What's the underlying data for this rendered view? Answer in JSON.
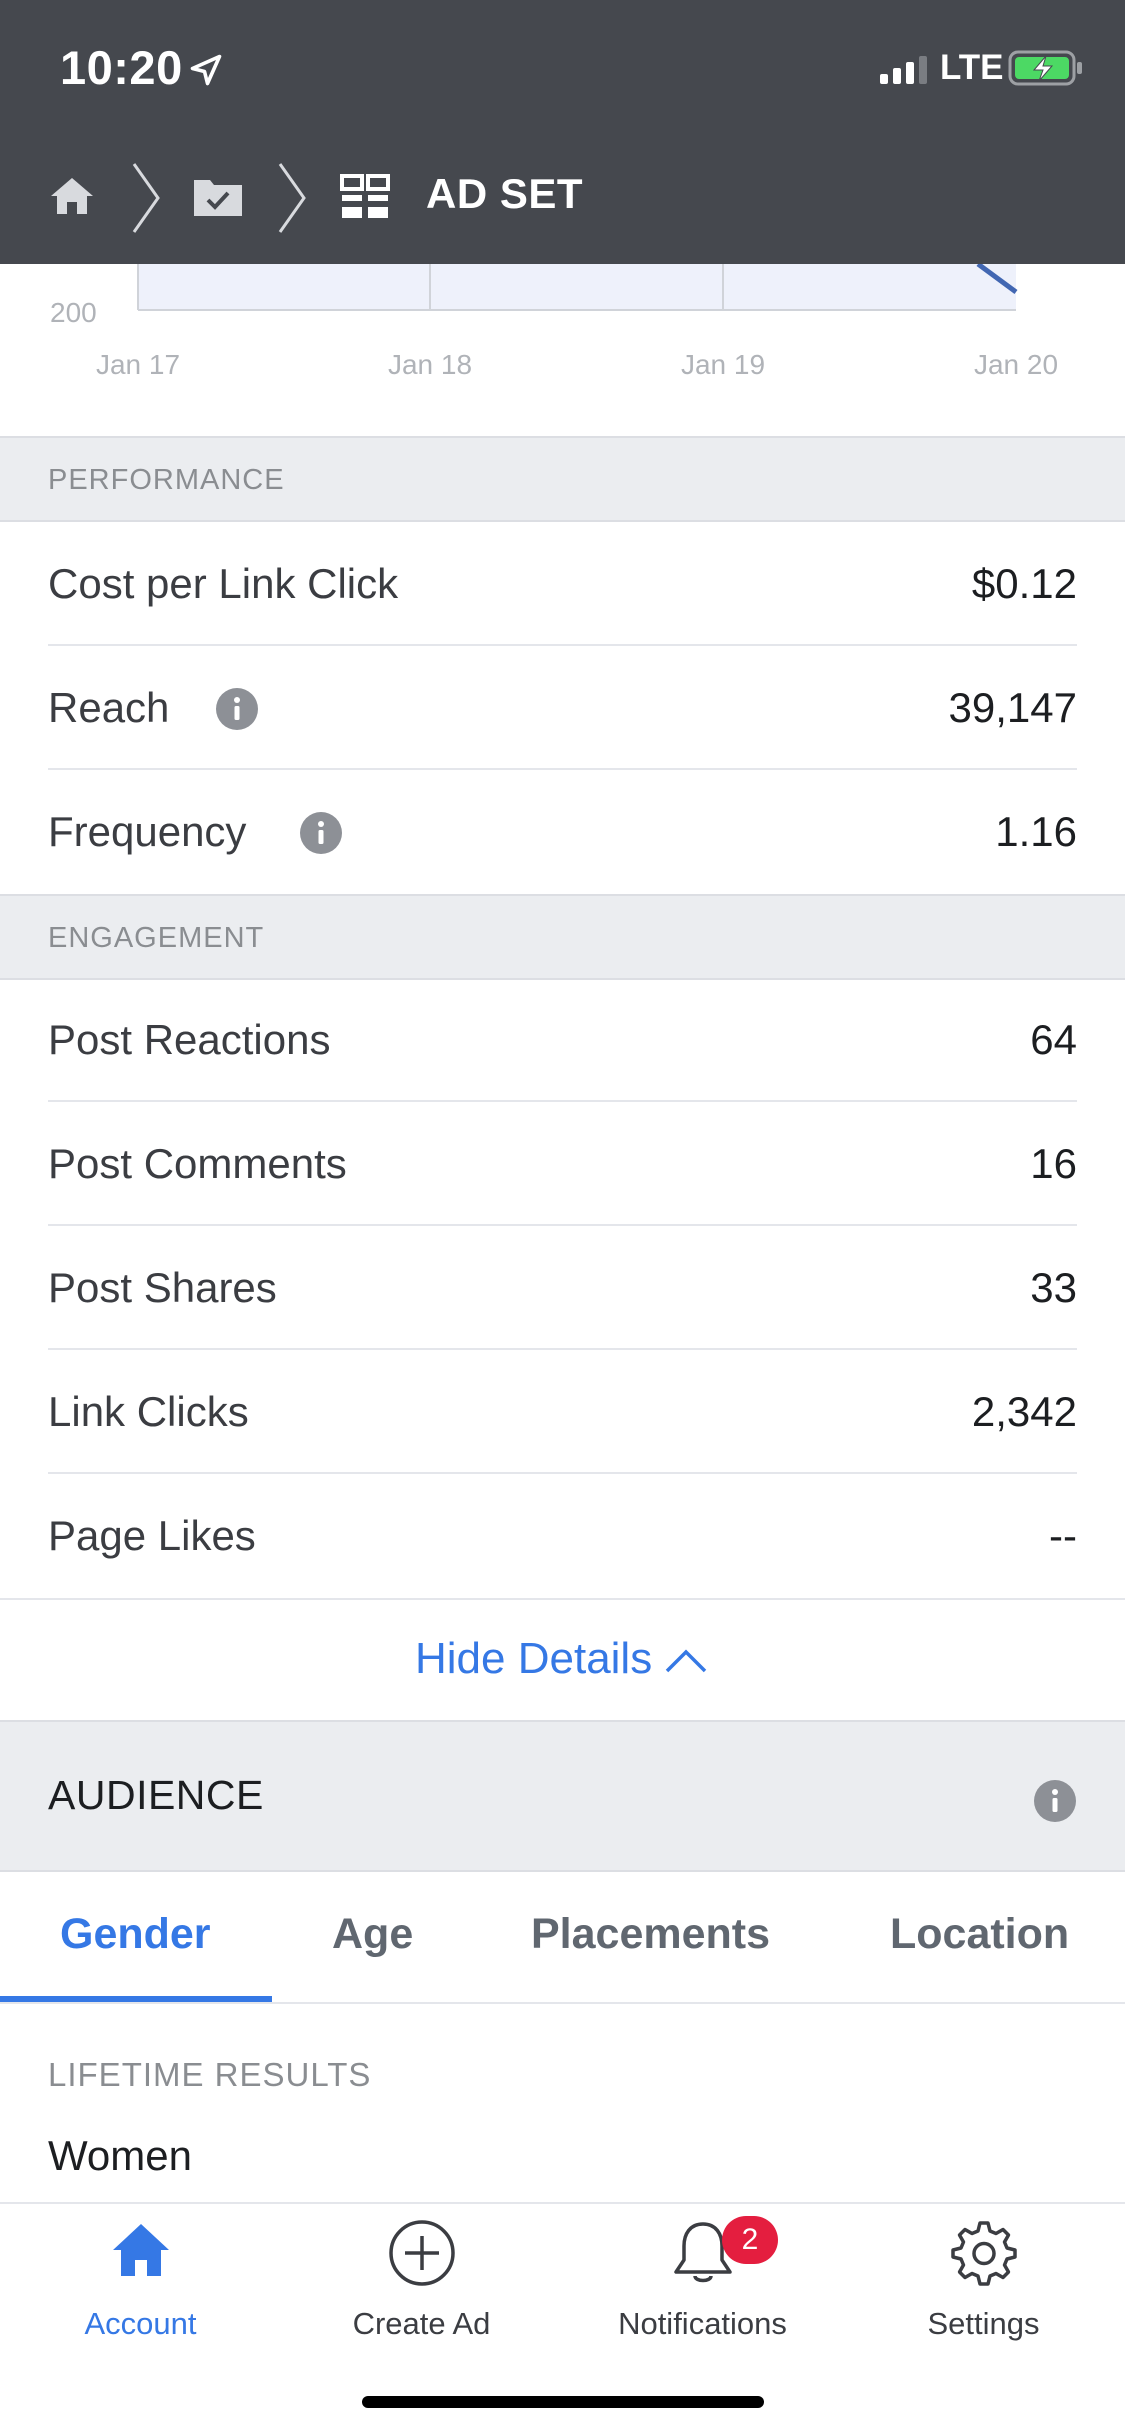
{
  "status_bar": {
    "time": "10:20",
    "network": "LTE"
  },
  "breadcrumb": {
    "title": "AD SET"
  },
  "chart_data": {
    "type": "line",
    "categories": [
      "Jan 17",
      "Jan 18",
      "Jan 19",
      "Jan 20"
    ],
    "y_tick_visible": "200",
    "series_color": "#4267b2"
  },
  "performance": {
    "header": "PERFORMANCE",
    "rows": [
      {
        "label": "Cost per Link Click",
        "value": "$0.12"
      },
      {
        "label": "Reach",
        "value": "39,147"
      },
      {
        "label": "Frequency",
        "value": "1.16"
      }
    ]
  },
  "engagement": {
    "header": "ENGAGEMENT",
    "rows": [
      {
        "label": "Post Reactions",
        "value": "64"
      },
      {
        "label": "Post Comments",
        "value": "16"
      },
      {
        "label": "Post Shares",
        "value": "33"
      },
      {
        "label": "Link Clicks",
        "value": "2,342"
      },
      {
        "label": "Page Likes",
        "value": "--"
      }
    ]
  },
  "hide_details_label": "Hide Details",
  "audience": {
    "title": "AUDIENCE",
    "tabs": [
      "Gender",
      "Age",
      "Placements",
      "Location"
    ],
    "active_tab": "Gender",
    "lifetime_label": "LIFETIME RESULTS",
    "first_item": "Women"
  },
  "bottom_nav": {
    "items": [
      {
        "label": "Account",
        "icon": "home-icon"
      },
      {
        "label": "Create Ad",
        "icon": "plus-circle-icon"
      },
      {
        "label": "Notifications",
        "icon": "bell-icon"
      },
      {
        "label": "Settings",
        "icon": "gear-icon"
      }
    ],
    "active": "Account",
    "notification_badge": "2"
  },
  "colors": {
    "accent": "#3578e5",
    "header_bg": "#45484e",
    "badge": "#e41e3f"
  }
}
